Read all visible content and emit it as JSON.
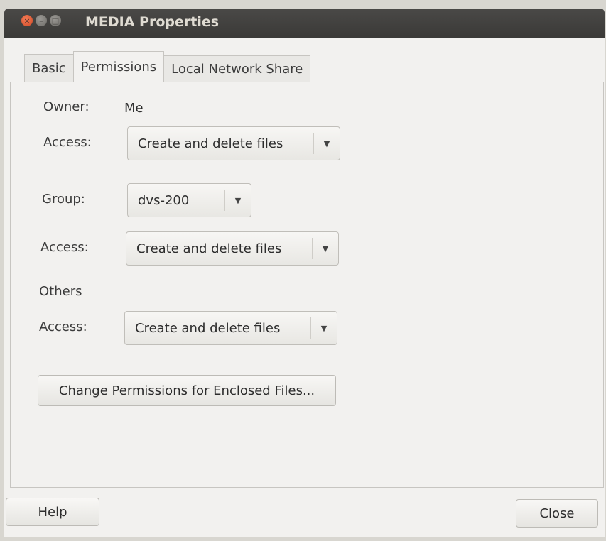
{
  "window": {
    "title": "MEDIA Properties",
    "controls": {
      "close_glyph": "×",
      "minimize_glyph": "–",
      "maximize_glyph": "□"
    }
  },
  "tabs": [
    {
      "label": "Basic"
    },
    {
      "label": "Permissions"
    },
    {
      "label": "Local Network Share"
    }
  ],
  "permissions": {
    "owner_label": "Owner:",
    "owner_value": "Me",
    "owner_access_label": "Access:",
    "owner_access_value": "Create and delete files",
    "group_label": "Group:",
    "group_value": "dvs-200",
    "group_access_label": "Access:",
    "group_access_value": "Create and delete files",
    "others_label": "Others",
    "others_access_label": "Access:",
    "others_access_value": "Create and delete files",
    "change_button_label": "Change Permissions for Enclosed Files..."
  },
  "footer": {
    "help_label": "Help",
    "close_label": "Close"
  },
  "icons": {
    "dropdown": "chevron-down-icon"
  },
  "colors": {
    "titlebar": "#3a3937",
    "close_button": "#e05a30",
    "window_bg": "#f2f1ef"
  }
}
